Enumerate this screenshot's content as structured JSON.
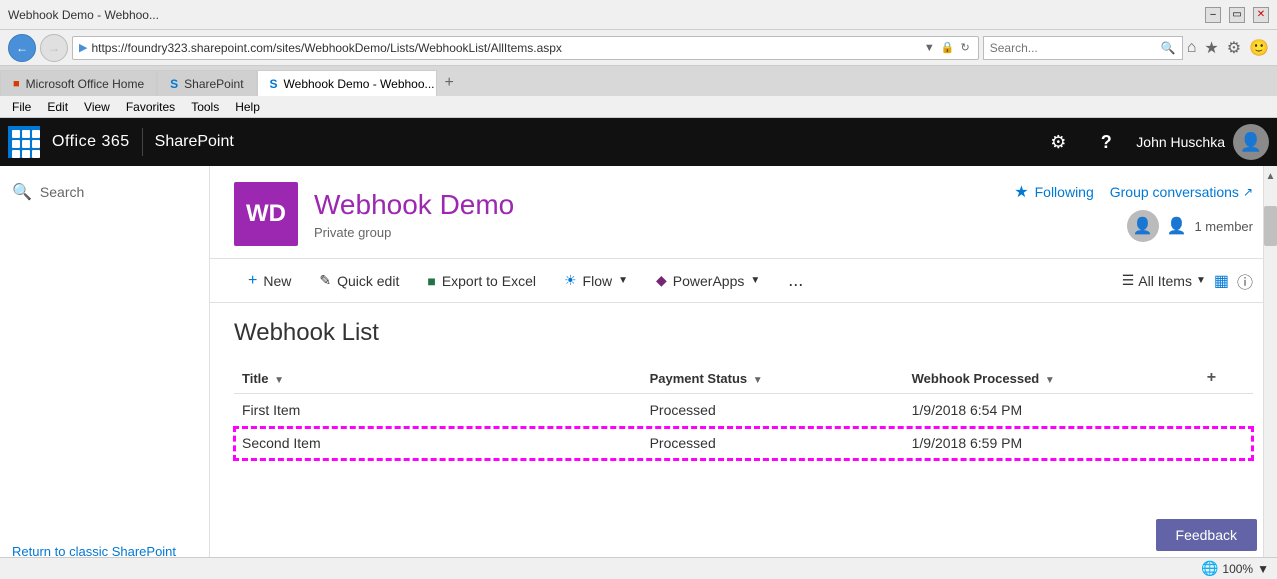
{
  "browser": {
    "title": "Webhook Demo - Webhoo...",
    "address": "https://foundry323.sharepoint.com/sites/WebhookDemo/Lists/WebhookList/AllItems.aspx",
    "search_placeholder": "Search...",
    "tabs": [
      {
        "label": "Microsoft Office Home",
        "icon": "office",
        "active": false,
        "closeable": false
      },
      {
        "label": "SharePoint",
        "icon": "sharepoint",
        "active": false,
        "closeable": false
      },
      {
        "label": "Webhook Demo - Webhoo...",
        "icon": "sharepoint",
        "active": true,
        "closeable": true
      }
    ],
    "menu": [
      "File",
      "Edit",
      "View",
      "Favorites",
      "Tools",
      "Help"
    ],
    "zoom": "100%"
  },
  "app_header": {
    "office_label": "Office 365",
    "sharepoint_label": "SharePoint",
    "waffle_label": "App launcher",
    "settings_label": "Settings",
    "help_label": "Help",
    "user_name": "John Huschka"
  },
  "sidebar": {
    "search_placeholder": "Search",
    "return_link": "Return to classic SharePoint"
  },
  "site": {
    "logo_initials": "WD",
    "title": "Webhook Demo",
    "subtitle": "Private group",
    "following_label": "Following",
    "group_conversations_label": "Group conversations",
    "members_count": "1 member"
  },
  "command_bar": {
    "new_label": "New",
    "quick_edit_label": "Quick edit",
    "export_label": "Export to Excel",
    "flow_label": "Flow",
    "powerapps_label": "PowerApps",
    "more_label": "...",
    "all_items_label": "All Items"
  },
  "list": {
    "title": "Webhook List",
    "columns": [
      {
        "label": "Title",
        "sortable": true
      },
      {
        "label": "Payment Status",
        "sortable": true
      },
      {
        "label": "Webhook Processed",
        "sortable": true
      }
    ],
    "rows": [
      {
        "title": "First Item",
        "payment_status": "Processed",
        "webhook_processed": "1/9/2018 6:54 PM",
        "selected": false
      },
      {
        "title": "Second Item",
        "payment_status": "Processed",
        "webhook_processed": "1/9/2018 6:59 PM",
        "selected": true
      }
    ]
  },
  "feedback": {
    "label": "Feedback"
  }
}
